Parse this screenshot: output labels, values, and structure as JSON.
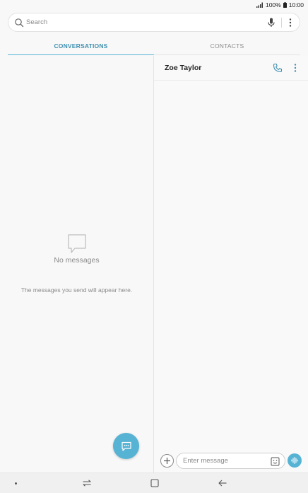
{
  "status_bar": {
    "battery": "100%",
    "time": "10:00"
  },
  "search": {
    "placeholder": "Search"
  },
  "tabs": [
    {
      "label": "CONVERSATIONS",
      "active": true
    },
    {
      "label": "CONTACTS",
      "active": false
    }
  ],
  "conversations": {
    "empty_title": "No messages",
    "empty_subtitle": "The messages you send will appear here."
  },
  "conversation": {
    "contact_name": "Zoe Taylor",
    "composer_placeholder": "Enter message"
  },
  "colors": {
    "accent": "#56b3d4",
    "tab_active_text": "#3d8fb0"
  },
  "icons": [
    "signal-icon",
    "battery-icon",
    "search-icon",
    "mic-icon",
    "more-icon",
    "empty-chat-icon",
    "compose-icon",
    "call-icon",
    "add-icon",
    "sticker-icon",
    "voice-icon",
    "recent-apps-icon",
    "home-icon",
    "back-icon"
  ]
}
